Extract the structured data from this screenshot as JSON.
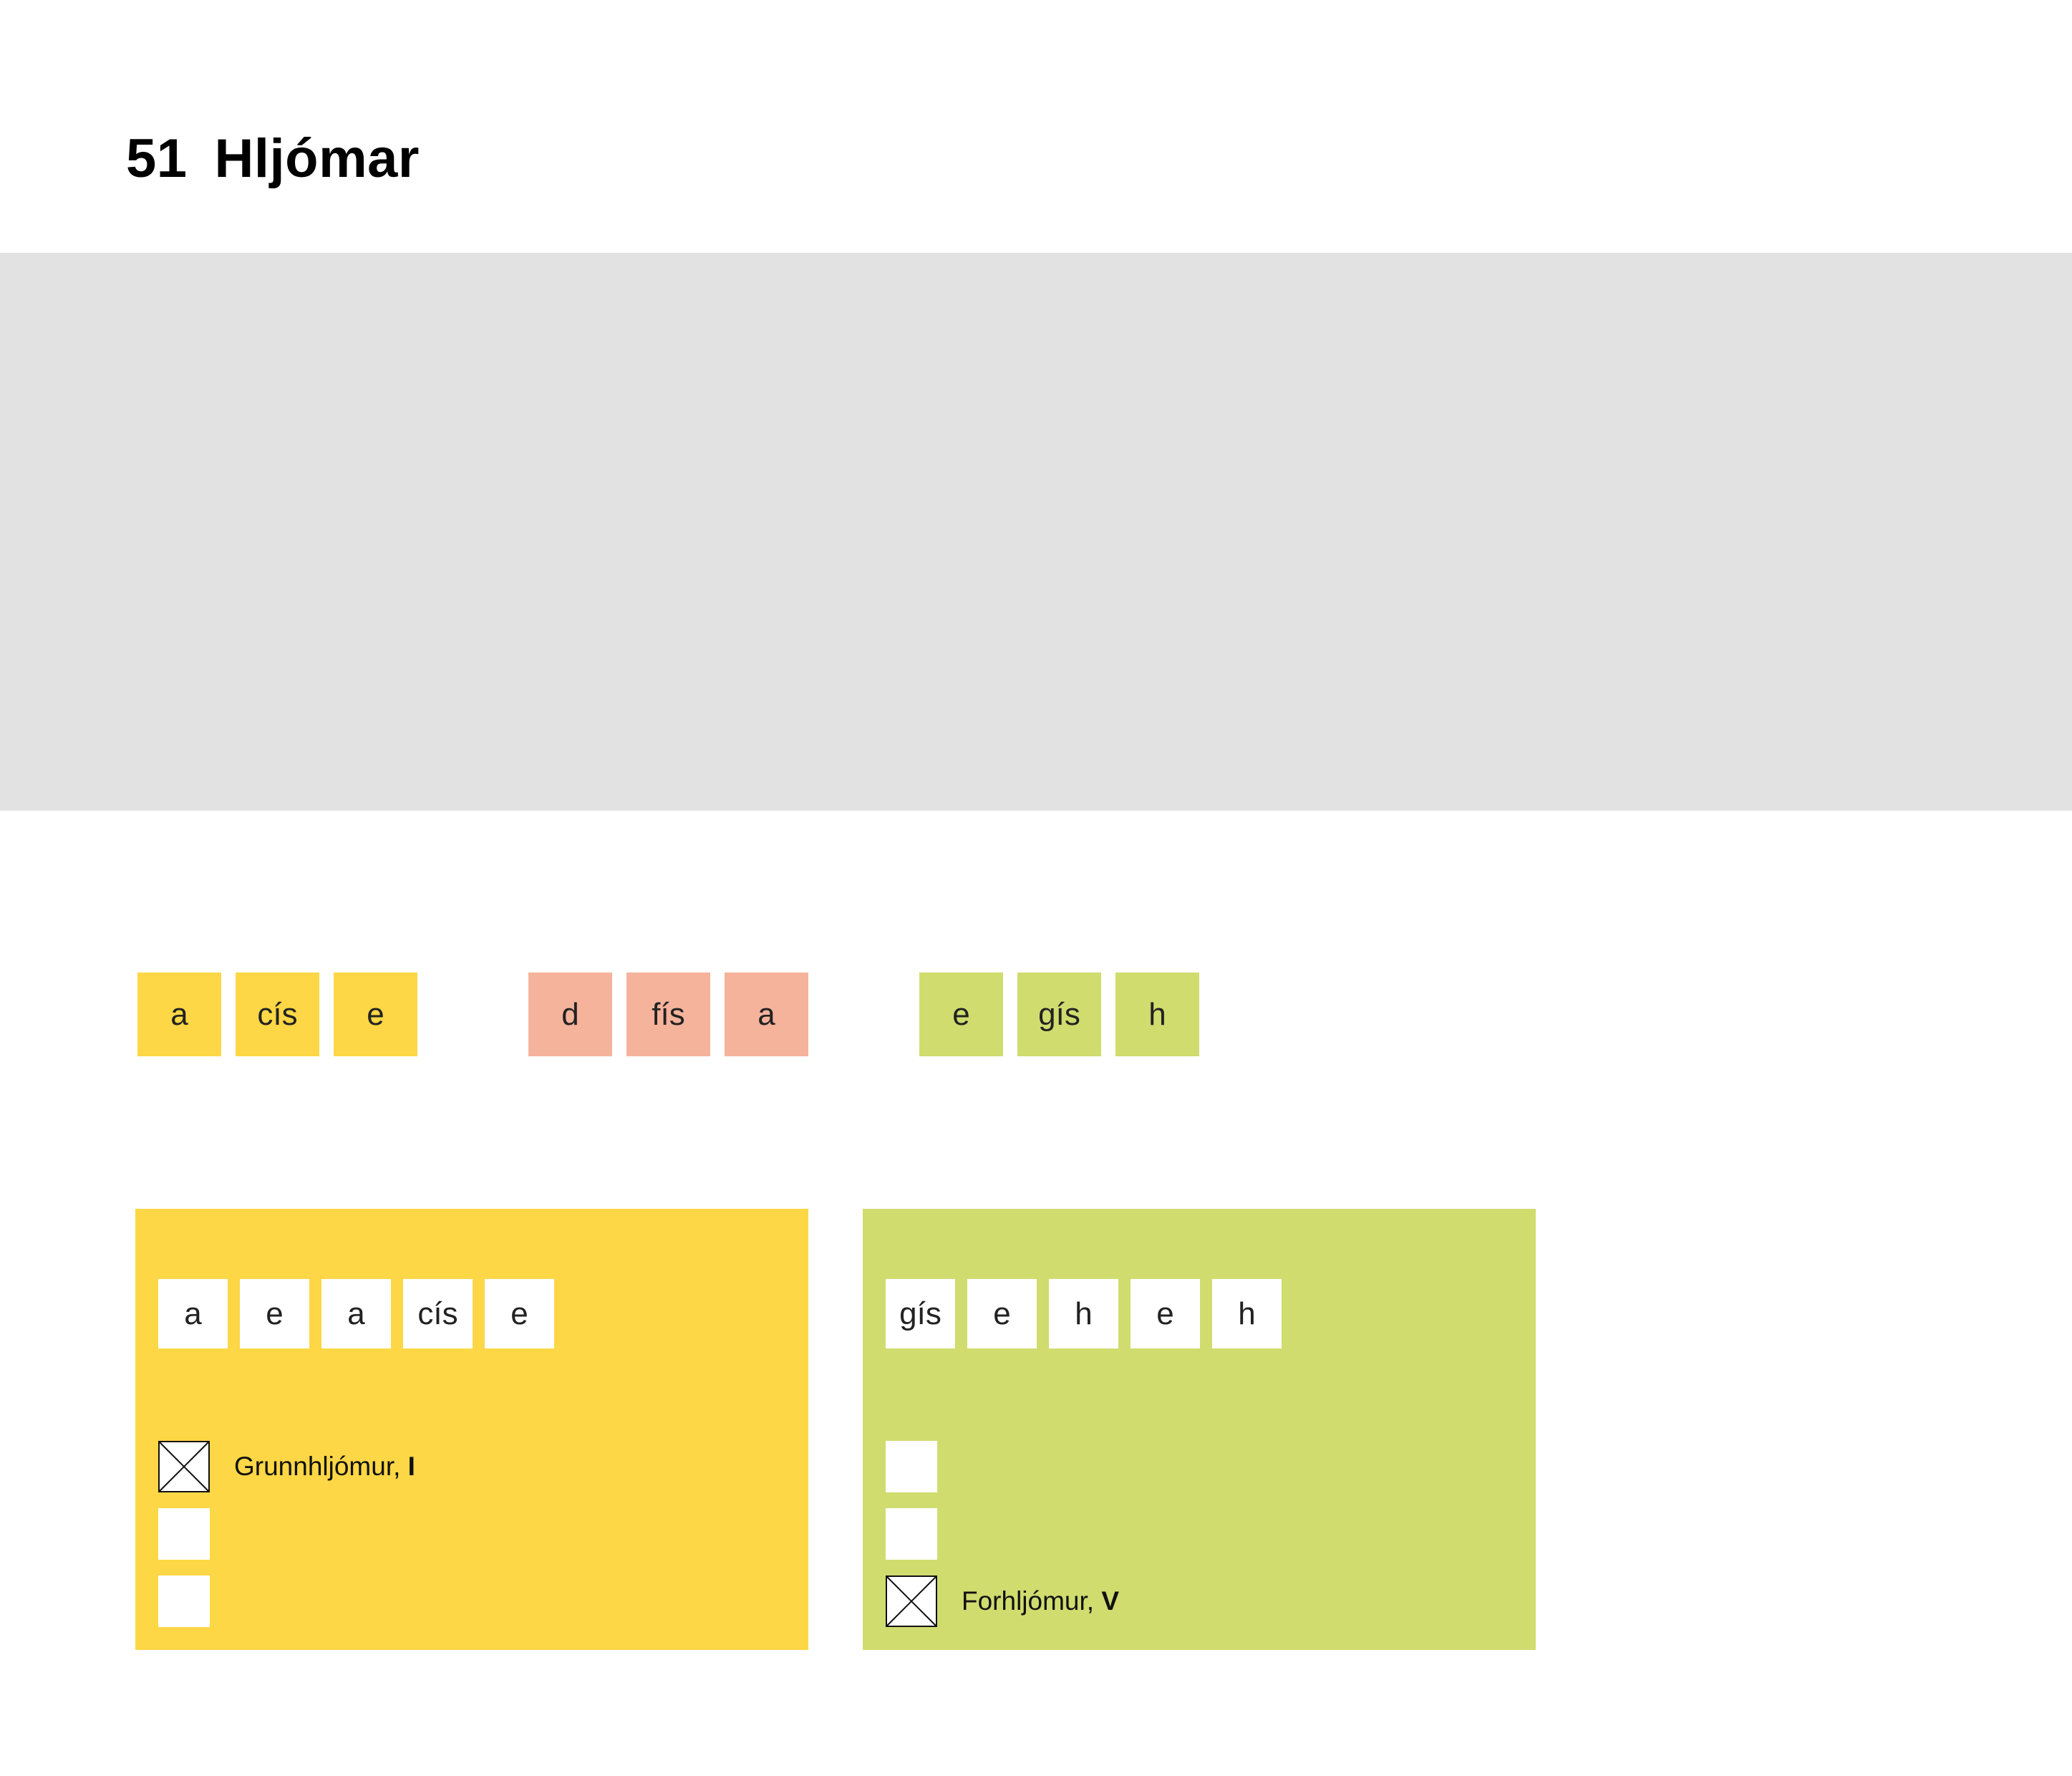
{
  "page": {
    "number": "51",
    "title": "Hljómar"
  },
  "colors": {
    "yellow": "#fdd745",
    "salmon": "#f6b39c",
    "green": "#d0dc6e",
    "media_panel": "#e2e2e2"
  },
  "chords": [
    {
      "color": "yellow",
      "notes": [
        "a",
        "cís",
        "e"
      ]
    },
    {
      "color": "salmon",
      "notes": [
        "d",
        "fís",
        "a"
      ]
    },
    {
      "color": "green",
      "notes": [
        "e",
        "gís",
        "h"
      ]
    }
  ],
  "cards": [
    {
      "color": "yellow",
      "answer_notes": [
        "a",
        "e",
        "a",
        "cís",
        "e"
      ],
      "options": [
        {
          "checked": true,
          "label": "Grunnhljómur, ",
          "numeral": "I"
        },
        {
          "checked": false,
          "label": "",
          "numeral": ""
        },
        {
          "checked": false,
          "label": "",
          "numeral": ""
        }
      ]
    },
    {
      "color": "green",
      "answer_notes": [
        "gís",
        "e",
        "h",
        "e",
        "h"
      ],
      "options": [
        {
          "checked": false,
          "label": "",
          "numeral": ""
        },
        {
          "checked": false,
          "label": "",
          "numeral": ""
        },
        {
          "checked": true,
          "label": "Forhljómur, ",
          "numeral": "V"
        }
      ]
    }
  ]
}
